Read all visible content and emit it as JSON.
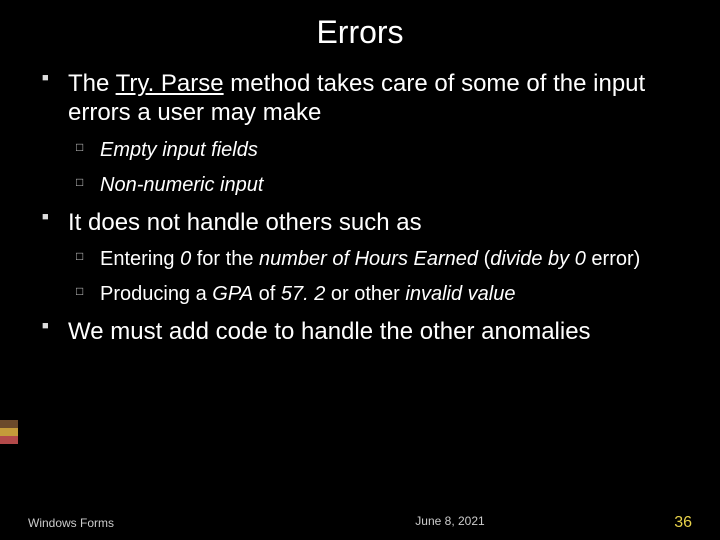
{
  "title": "Errors",
  "bullets": {
    "b1_pre": "The ",
    "b1_uline": "Try. Parse",
    "b1_post": " method takes care of some of the input errors a user may make",
    "b1a": "Empty input fields",
    "b1b": "Non-numeric input",
    "b2": "It does not handle others such as",
    "b2a_pre": "Entering ",
    "b2a_ital1": "0",
    "b2a_mid1": " for the ",
    "b2a_ital2": "number of Hours Earned",
    "b2a_mid2": " (",
    "b2a_ital3": "divide by 0",
    "b2a_post": " error)",
    "b2b_pre": "Producing a ",
    "b2b_ital1": "GPA",
    "b2b_mid1": " of ",
    "b2b_ital2": "57. 2",
    "b2b_mid2": " or other ",
    "b2b_ital3": "invalid value",
    "b3": "We must add code to handle the other anomalies"
  },
  "footer": {
    "left": "Windows Forms",
    "center": "June 8, 2021",
    "right": "36"
  },
  "accent": [
    "#6b4a2b",
    "#c49b3a",
    "#b34a4a"
  ]
}
